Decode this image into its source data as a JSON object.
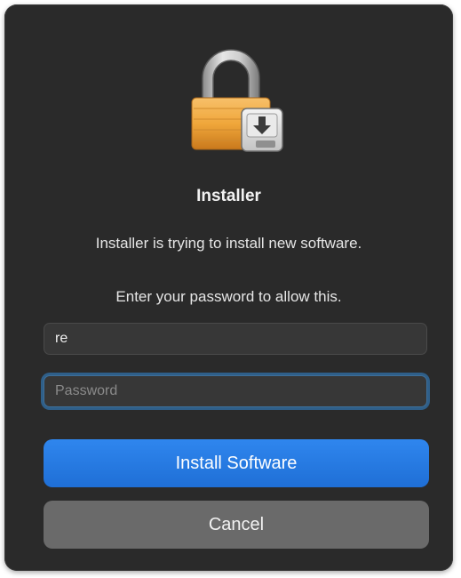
{
  "dialog": {
    "icon": "installer-lock-icon",
    "title": "Installer",
    "message": "Installer is trying to install new software.",
    "prompt": "Enter your password to allow this."
  },
  "fields": {
    "username_value": "re",
    "password_placeholder": "Password",
    "password_value": ""
  },
  "buttons": {
    "install_label": "Install Software",
    "cancel_label": "Cancel"
  },
  "colors": {
    "dialog_bg": "#2a2a2a",
    "accent": "#1f6fd6",
    "focus_ring": "#2f5f89",
    "secondary_button": "#6a6a6a",
    "lock_body": "#f0a73b"
  }
}
